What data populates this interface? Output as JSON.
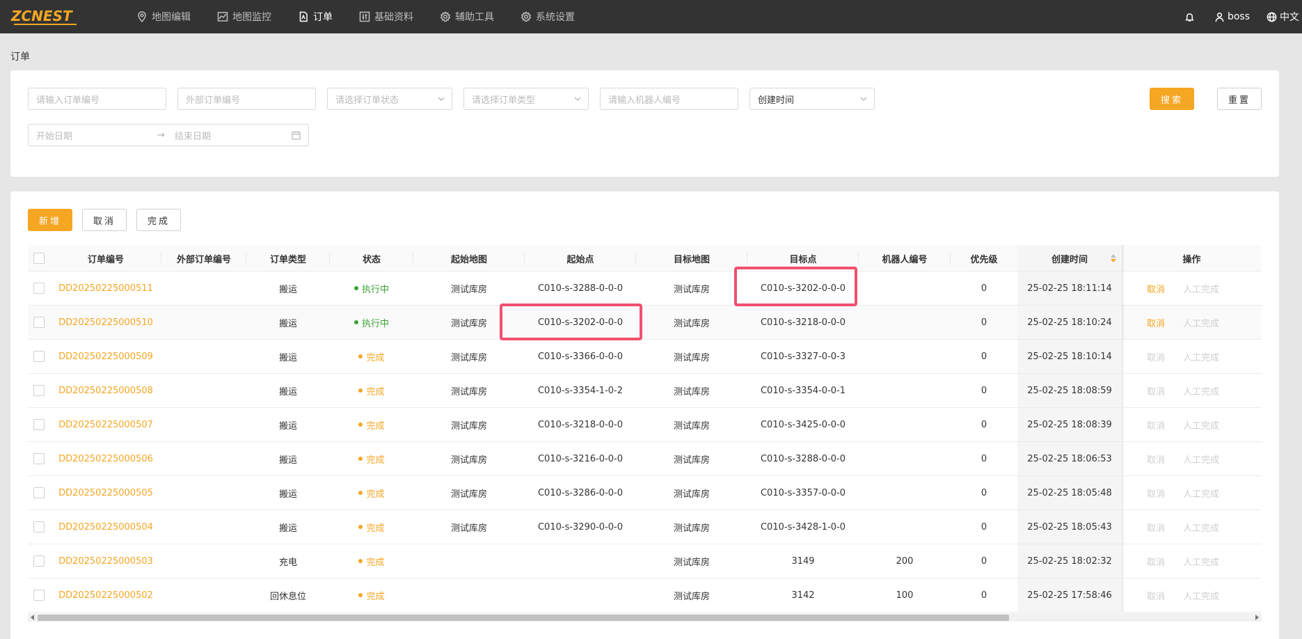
{
  "app": {
    "logo": "ZCNEST"
  },
  "nav": {
    "items": [
      {
        "label": "地图编辑",
        "icon": "map-pin-icon"
      },
      {
        "label": "地图监控",
        "icon": "line-chart-icon"
      },
      {
        "label": "订单",
        "icon": "document-icon",
        "active": true
      },
      {
        "label": "基础资料",
        "icon": "sliders-icon"
      },
      {
        "label": "辅助工具",
        "icon": "gear-icon"
      },
      {
        "label": "系统设置",
        "icon": "gear-icon"
      }
    ],
    "user": "boss",
    "language": "中文"
  },
  "breadcrumb": "订单",
  "filters": {
    "order_no_placeholder": "请输入订单编号",
    "ext_order_no_placeholder": "外部订单编号",
    "status_placeholder": "请选择订单状态",
    "type_placeholder": "请选择订单类型",
    "robot_placeholder": "请输入机器人编号",
    "time_field": "创建时间",
    "start_date_placeholder": "开始日期",
    "end_date_placeholder": "结束日期",
    "search_label": "搜索",
    "reset_label": "重置"
  },
  "toolbar": {
    "add_label": "新增",
    "cancel_label": "取消",
    "complete_label": "完成"
  },
  "table": {
    "columns": [
      "订单编号",
      "外部订单编号",
      "订单类型",
      "状态",
      "起始地图",
      "起始点",
      "目标地图",
      "目标点",
      "机器人编号",
      "优先级",
      "创建时间",
      "操作"
    ],
    "actions": {
      "cancel": "取消",
      "manual_complete": "人工完成"
    },
    "rows": [
      {
        "order_no": "DD20250225000511",
        "ext_no": "",
        "type": "搬运",
        "status": "执行中",
        "status_kind": "running",
        "start_map": "测试库房",
        "start_point": "C010-s-3288-0-0-0",
        "target_map": "测试库房",
        "target_point": "C010-s-3202-0-0-0",
        "robot": "",
        "priority": "0",
        "created": "25-02-25 18:11:14",
        "cancel_enabled": true
      },
      {
        "order_no": "DD20250225000510",
        "ext_no": "",
        "type": "搬运",
        "status": "执行中",
        "status_kind": "running",
        "start_map": "测试库房",
        "start_point": "C010-s-3202-0-0-0",
        "target_map": "测试库房",
        "target_point": "C010-s-3218-0-0-0",
        "robot": "",
        "priority": "0",
        "created": "25-02-25 18:10:24",
        "cancel_enabled": true
      },
      {
        "order_no": "DD20250225000509",
        "ext_no": "",
        "type": "搬运",
        "status": "完成",
        "status_kind": "done",
        "start_map": "测试库房",
        "start_point": "C010-s-3366-0-0-0",
        "target_map": "测试库房",
        "target_point": "C010-s-3327-0-0-3",
        "robot": "",
        "priority": "0",
        "created": "25-02-25 18:10:14",
        "cancel_enabled": false
      },
      {
        "order_no": "DD20250225000508",
        "ext_no": "",
        "type": "搬运",
        "status": "完成",
        "status_kind": "done",
        "start_map": "测试库房",
        "start_point": "C010-s-3354-1-0-2",
        "target_map": "测试库房",
        "target_point": "C010-s-3354-0-0-1",
        "robot": "",
        "priority": "0",
        "created": "25-02-25 18:08:59",
        "cancel_enabled": false
      },
      {
        "order_no": "DD20250225000507",
        "ext_no": "",
        "type": "搬运",
        "status": "完成",
        "status_kind": "done",
        "start_map": "测试库房",
        "start_point": "C010-s-3218-0-0-0",
        "target_map": "测试库房",
        "target_point": "C010-s-3425-0-0-0",
        "robot": "",
        "priority": "0",
        "created": "25-02-25 18:08:39",
        "cancel_enabled": false
      },
      {
        "order_no": "DD20250225000506",
        "ext_no": "",
        "type": "搬运",
        "status": "完成",
        "status_kind": "done",
        "start_map": "测试库房",
        "start_point": "C010-s-3216-0-0-0",
        "target_map": "测试库房",
        "target_point": "C010-s-3288-0-0-0",
        "robot": "",
        "priority": "0",
        "created": "25-02-25 18:06:53",
        "cancel_enabled": false
      },
      {
        "order_no": "DD20250225000505",
        "ext_no": "",
        "type": "搬运",
        "status": "完成",
        "status_kind": "done",
        "start_map": "测试库房",
        "start_point": "C010-s-3286-0-0-0",
        "target_map": "测试库房",
        "target_point": "C010-s-3357-0-0-0",
        "robot": "",
        "priority": "0",
        "created": "25-02-25 18:05:48",
        "cancel_enabled": false
      },
      {
        "order_no": "DD20250225000504",
        "ext_no": "",
        "type": "搬运",
        "status": "完成",
        "status_kind": "done",
        "start_map": "测试库房",
        "start_point": "C010-s-3290-0-0-0",
        "target_map": "测试库房",
        "target_point": "C010-s-3428-1-0-0",
        "robot": "",
        "priority": "0",
        "created": "25-02-25 18:05:43",
        "cancel_enabled": false
      },
      {
        "order_no": "DD20250225000503",
        "ext_no": "",
        "type": "充电",
        "status": "完成",
        "status_kind": "done",
        "start_map": "",
        "start_point": "",
        "target_map": "测试库房",
        "target_point": "3149",
        "robot": "200",
        "priority": "0",
        "created": "25-02-25 18:02:32",
        "cancel_enabled": false
      },
      {
        "order_no": "DD20250225000502",
        "ext_no": "",
        "type": "回休息位",
        "status": "完成",
        "status_kind": "done",
        "start_map": "",
        "start_point": "",
        "target_map": "测试库房",
        "target_point": "3142",
        "robot": "100",
        "priority": "0",
        "created": "25-02-25 17:58:46",
        "cancel_enabled": false
      }
    ]
  },
  "colors": {
    "accent": "#f5a623",
    "running": "#3aa335",
    "highlight": "#f0506e",
    "topbar": "#333333"
  }
}
